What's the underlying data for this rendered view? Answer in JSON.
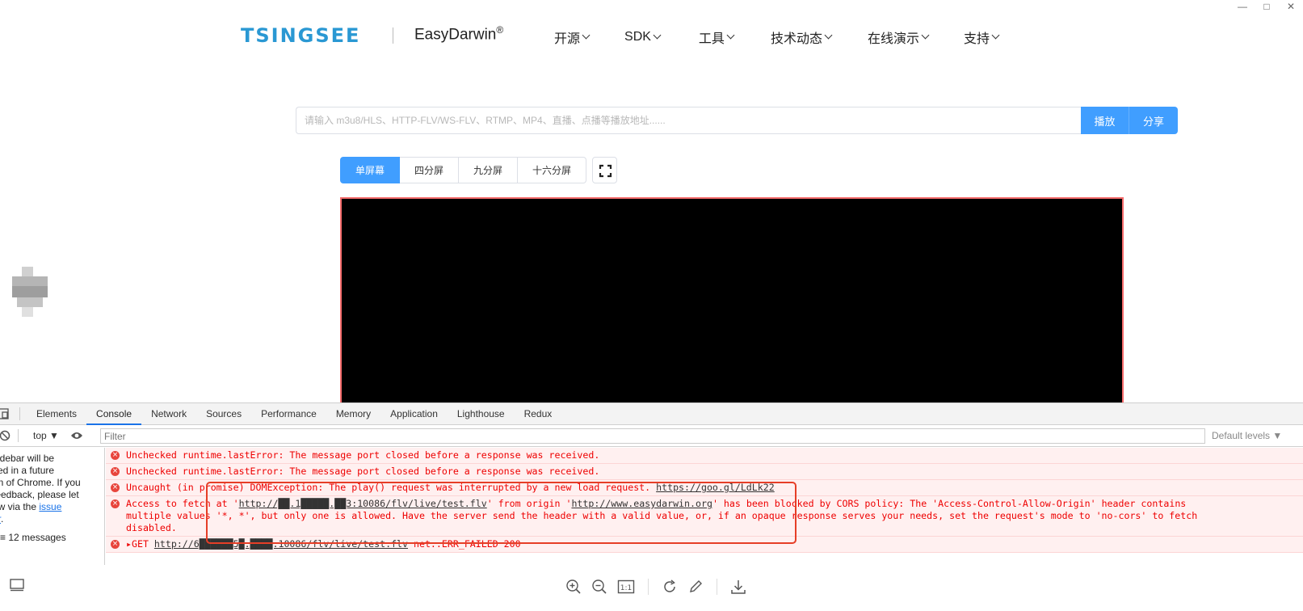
{
  "window": {
    "minimize": "—",
    "maximize": "□",
    "close": "✕"
  },
  "header": {
    "logo_text": "TSINGSEE",
    "brand": "EasyDarwin",
    "brand_mark": "®",
    "nav": [
      {
        "label": "开源"
      },
      {
        "label": "SDK"
      },
      {
        "label": "工具"
      },
      {
        "label": "技术动态"
      },
      {
        "label": "在线演示"
      },
      {
        "label": "支持"
      }
    ]
  },
  "player": {
    "url_placeholder": "请输入 m3u8/HLS、HTTP-FLV/WS-FLV、RTMP、MP4、直播、点播等播放地址......",
    "play_label": "播放",
    "share_label": "分享",
    "splits": [
      "单屏幕",
      "四分屏",
      "九分屏",
      "十六分屏"
    ],
    "active_split": "单屏幕"
  },
  "devtools": {
    "tabs": [
      "Elements",
      "Console",
      "Network",
      "Sources",
      "Performance",
      "Memory",
      "Application",
      "Lighthouse",
      "Redux"
    ],
    "active_tab": "Console",
    "context": "top ▼",
    "filter_placeholder": "Filter",
    "levels": "Default levels ▼",
    "sidebar_lines": [
      "sidebar will be",
      "ved in a future",
      "on of Chrome. If you",
      "feedback, please let",
      "ow via the"
    ],
    "sidebar_link": "issue",
    "sidebar_link2": "er",
    "sidebar_link2_suffix": ".",
    "sidebar_count": "12 messages",
    "messages": [
      {
        "text": "Unchecked runtime.lastError: The message port closed before a response was received."
      },
      {
        "text": "Unchecked runtime.lastError: The message port closed before a response was received."
      },
      {
        "text": "Uncaught (in promise) DOMException: The play() request was interrupted by a new load request. ",
        "link": "https://goo.gl/LdLk22"
      },
      {
        "prefix": "Access to fetch at '",
        "url1": "http://██.1█████.██3:10086/flv/live/test.flv",
        "mid": "' from origin '",
        "url2": "http://www.easydarwin.org",
        "suffix": "' has been blocked by CORS policy: The 'Access-Control-Allow-Origin' header contains\nmultiple values '*, *', but only one is allowed. Have the server send the header with a valid value, or, if an opaque response serves your needs, set the request's mode to 'no-cors' to fetch\ndisabled."
      },
      {
        "prefix": "▸GET ",
        "link": "http://6██████5█.████:10086/flv/live/test.flv",
        "suffix": " net::ERR_FAILED 200"
      }
    ]
  },
  "colors": {
    "accent": "#409eff",
    "error": "#e00000",
    "highlight": "#e63e27",
    "logo": "#2a98d3"
  },
  "viewer_icons": [
    "zoom-in-icon",
    "zoom-out-icon",
    "actual-size-icon",
    "rotate-icon",
    "edit-icon",
    "download-icon"
  ]
}
